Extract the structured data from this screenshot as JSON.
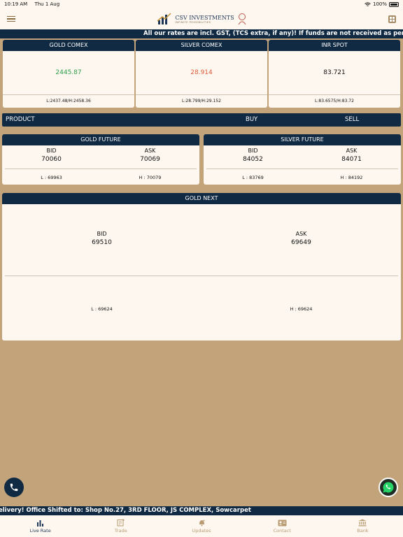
{
  "status": {
    "time": "10:19 AM",
    "date": "Thu 1 Aug",
    "battery": "100%"
  },
  "brand": {
    "name": "CSV INVESTMENTS",
    "tagline": "INFINITE POSSIBILITIES"
  },
  "ticker_top": "All our rates are incl. GST, (TCS extra, if any)! If funds are not received as per commitments, t",
  "comex": [
    {
      "title": "GOLD COMEX",
      "value": "2445.87",
      "range": "L:2437.48/H:2458.36",
      "color": "#2e9e4c"
    },
    {
      "title": "SILVER COMEX",
      "value": "28.914",
      "range": "L:28.799/H:29.152",
      "color": "#e05a3a"
    },
    {
      "title": "INR SPOT",
      "value": "83.721",
      "range": "L:83.6575/H:83.72",
      "color": "#111111"
    }
  ],
  "product_bar": {
    "product": "PRODUCT",
    "buy": "BUY",
    "sell": "SELL"
  },
  "futures": [
    {
      "title": "GOLD FUTURE",
      "bid_label": "BID",
      "bid": "70060",
      "ask_label": "ASK",
      "ask": "70069",
      "low": "L : 69963",
      "high": "H : 70079"
    },
    {
      "title": "SILVER FUTURE",
      "bid_label": "BID",
      "bid": "84052",
      "ask_label": "ASK",
      "ask": "84071",
      "low": "L : 83769",
      "high": "H : 84192"
    }
  ],
  "gold_next": {
    "title": "GOLD NEXT",
    "bid_label": "BID",
    "bid": "69510",
    "ask_label": "ASK",
    "ask": "69649",
    "low": "L : 69624",
    "high": "H : 69624"
  },
  "ticker_bottom": "elivery! Office Shifted to: Shop No.27, 3RD FLOOR, JS COMPLEX, Sowcarpet",
  "tabs": [
    {
      "label": "Live Rate",
      "icon": "bar-chart-icon",
      "active": true
    },
    {
      "label": "Trade",
      "icon": "trade-icon",
      "active": false
    },
    {
      "label": "Updates",
      "icon": "updates-icon",
      "active": false
    },
    {
      "label": "Contact",
      "icon": "contact-icon",
      "active": false
    },
    {
      "label": "Bank",
      "icon": "bank-icon",
      "active": false
    }
  ],
  "colors": {
    "navy": "#102a43",
    "cream": "#fdf7ef",
    "tan": "#c3a37a",
    "whatsapp": "#25d366"
  }
}
